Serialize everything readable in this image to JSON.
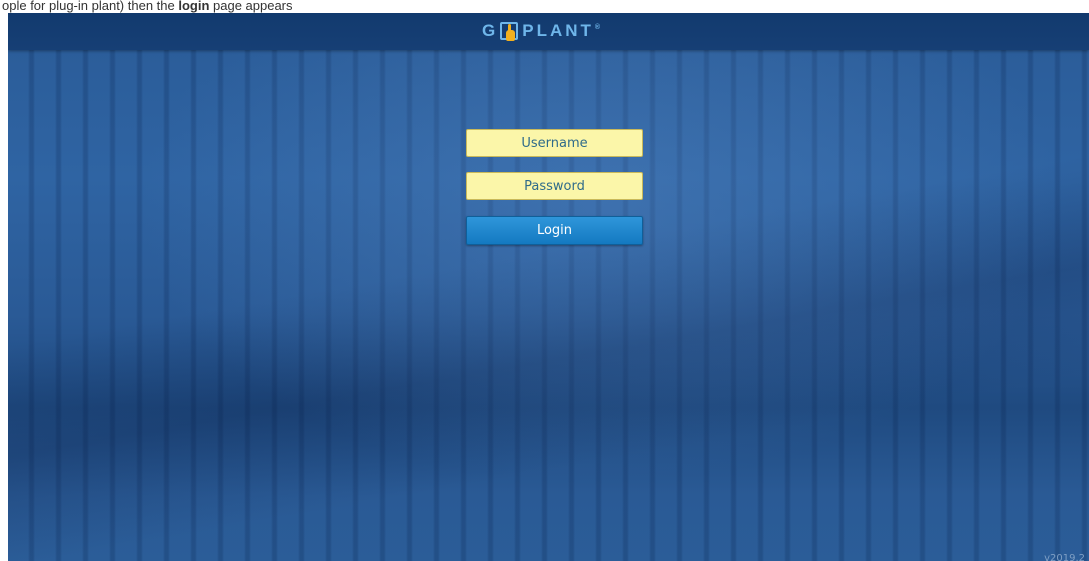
{
  "caption": {
    "prefix": "ople for plug-in plant) then the ",
    "bold": "login",
    "suffix": " page appears"
  },
  "header": {
    "logo_left": "G",
    "logo_right": "PLANT",
    "logo_reg": "®",
    "logo_icon": "hand-pointer-icon",
    "accent_color": "#6fb6ea",
    "bar_color": "#123a6e"
  },
  "login": {
    "username_placeholder": "Username",
    "password_placeholder": "Password",
    "login_label": "Login",
    "field_color": "#fbf6a9",
    "button_color": "#1a84cc"
  },
  "footer": {
    "version": "v2019.2"
  }
}
